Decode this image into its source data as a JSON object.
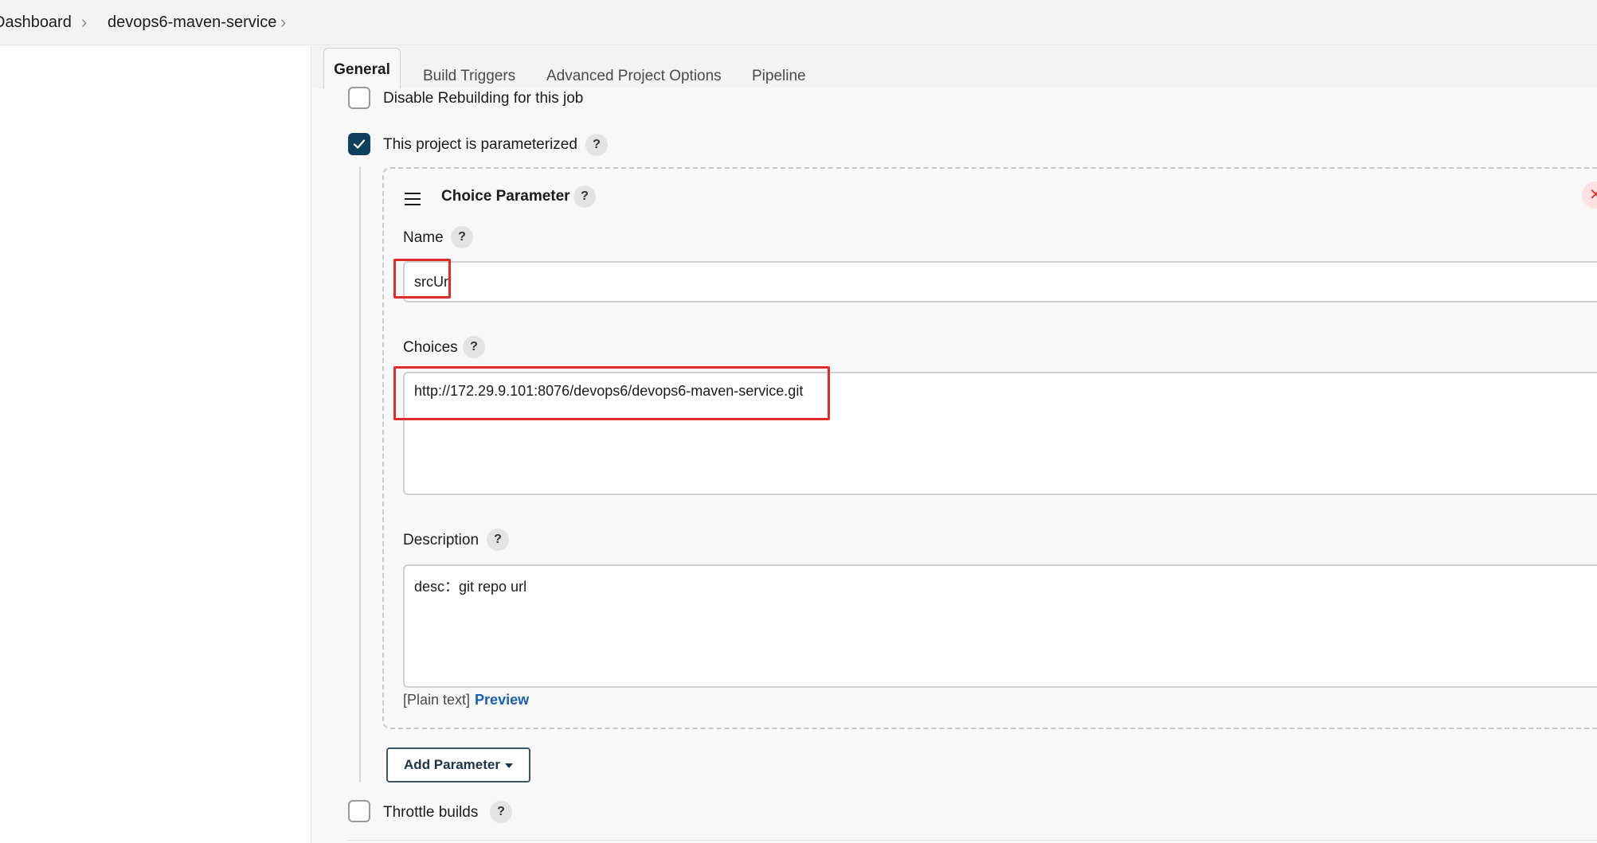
{
  "breadcrumb": {
    "items": [
      "Dashboard",
      "devops6-maven-service"
    ],
    "separator": ">"
  },
  "tabs": [
    "General",
    "Build Triggers",
    "Advanced Project Options",
    "Pipeline"
  ],
  "options": {
    "disable_rebuilding": {
      "label": "Disable Rebuilding for this job",
      "checked": false
    },
    "parameterized": {
      "label": "This project is parameterized",
      "checked": true
    },
    "throttle_builds": {
      "label": "Throttle builds",
      "checked": false
    }
  },
  "parameter": {
    "title": "Choice Parameter",
    "name_label": "Name",
    "name_value": "srcUrl",
    "choices_label": "Choices",
    "choices_value": "http://172.29.9.101:8076/devops6/devops6-maven-service.git",
    "description_label": "Description",
    "description_value": "desc：git repo url",
    "format_note": "[Plain text]",
    "preview_label": "Preview"
  },
  "add_parameter_label": "Add Parameter",
  "icons": {
    "help": "?",
    "delete": "✕",
    "chevron": "›"
  },
  "colors": {
    "checkbox_checked": "#0e3f5c",
    "highlight": "#e02b2b",
    "link": "#1a5fb4",
    "delete": "#d93434"
  }
}
